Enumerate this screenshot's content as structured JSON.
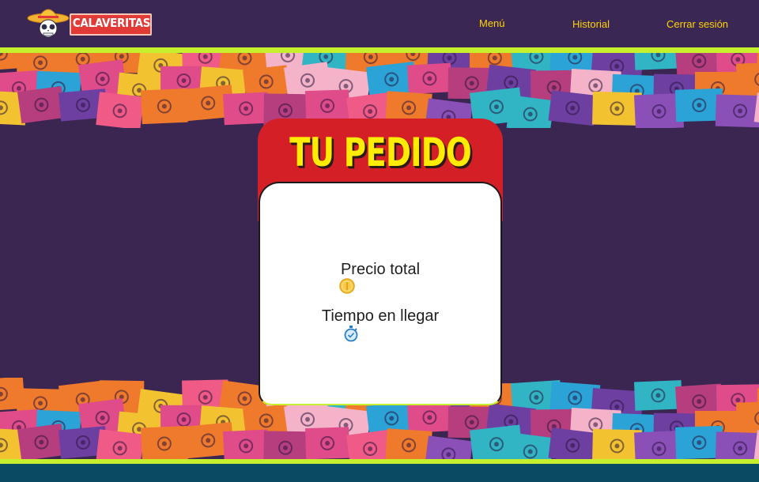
{
  "header": {
    "logo_text": "CALAVERITAS",
    "nav": {
      "menu": "Menú",
      "history": "Historial",
      "logout": "Cerrar sesión"
    }
  },
  "order_card": {
    "title": "TU PEDIDO",
    "total_price_label": "Precio total",
    "delivery_time_label": "Tiempo en llegar"
  },
  "icons": [
    "skull-sombrero-icon",
    "coin-icon",
    "stopwatch-icon"
  ],
  "colors": {
    "background": "#3a2650",
    "accent_stripe": "#c6f02e",
    "card_header": "#d41f26",
    "title_yellow": "#ffec00",
    "nav_link": "#ffd400",
    "footer": "#0b4a63"
  }
}
